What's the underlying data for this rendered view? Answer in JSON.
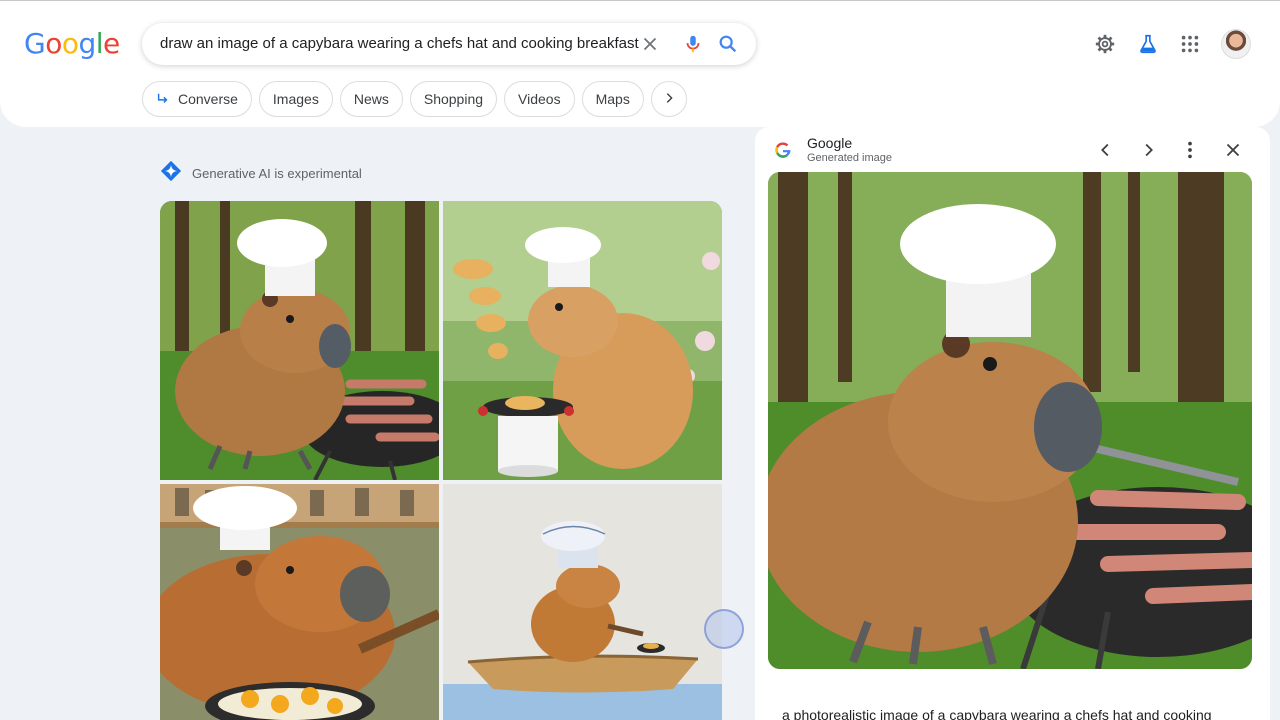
{
  "logo": {
    "text": "Google",
    "letters": [
      "G",
      "o",
      "o",
      "g",
      "l",
      "e"
    ],
    "colors": [
      "#4285f4",
      "#ea4335",
      "#fbbc05",
      "#4285f4",
      "#34a853",
      "#ea4335"
    ]
  },
  "search": {
    "query": "draw an image of a capybara wearing a chefs hat and cooking breakfast"
  },
  "chips": [
    {
      "label": "Converse",
      "icon": "converse-arrow-icon"
    },
    {
      "label": "Images"
    },
    {
      "label": "News"
    },
    {
      "label": "Shopping"
    },
    {
      "label": "Videos"
    },
    {
      "label": "Maps"
    }
  ],
  "header_icons": [
    "gear-icon",
    "labs-flask-icon",
    "apps-grid-icon",
    "avatar"
  ],
  "ai": {
    "label": "Generative AI is experimental",
    "icon": "gemini-sparkle-icon"
  },
  "images": [
    {
      "name": "capybara-chef-grill-forest"
    },
    {
      "name": "capybara-chef-pancakes-pot"
    },
    {
      "name": "capybara-chef-frying-eggs"
    },
    {
      "name": "capybara-chef-boat"
    }
  ],
  "panel": {
    "title": "Google",
    "subtitle": "Generated image",
    "caption": "a photorealistic image of a capybara wearing a chefs hat and cooking"
  },
  "colors": {
    "accent": "#1a73e8",
    "page_bg": "#eef2f7"
  }
}
